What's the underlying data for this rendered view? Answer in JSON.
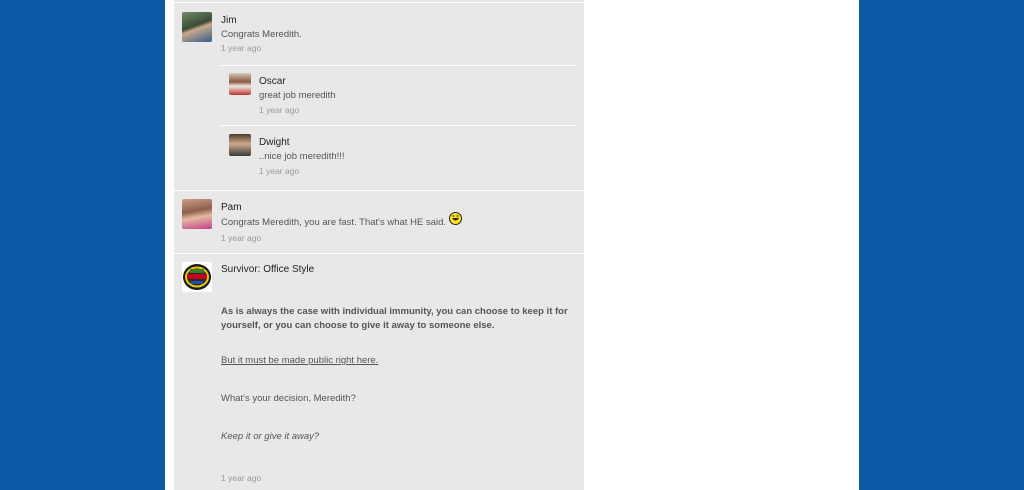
{
  "comments": [
    {
      "name": "Jim",
      "text": "Congrats Meredith.",
      "time": "1 year ago",
      "replies": [
        {
          "name": "Oscar",
          "text": "great job meredith",
          "time": "1 year ago"
        },
        {
          "name": "Dwight",
          "text": "..nice job meredith!!!",
          "time": "1 year ago"
        }
      ]
    },
    {
      "name": "Pam",
      "text": "Congrats Meredith, you are fast.  That's what HE said.",
      "time": "1 year ago"
    },
    {
      "name": "Survivor: Office Style",
      "paragraphs": [
        "As is always the case with individual immunity, you can choose to keep it for yourself, or you can choose to give it away to someone else.",
        "But it must be made public right here.",
        "What's your decision, Meredith?",
        "Keep it or give it away?"
      ],
      "time": "1 year ago"
    }
  ],
  "colors": {
    "background": "#0a5aa8",
    "feed": "#e8e8e8"
  }
}
